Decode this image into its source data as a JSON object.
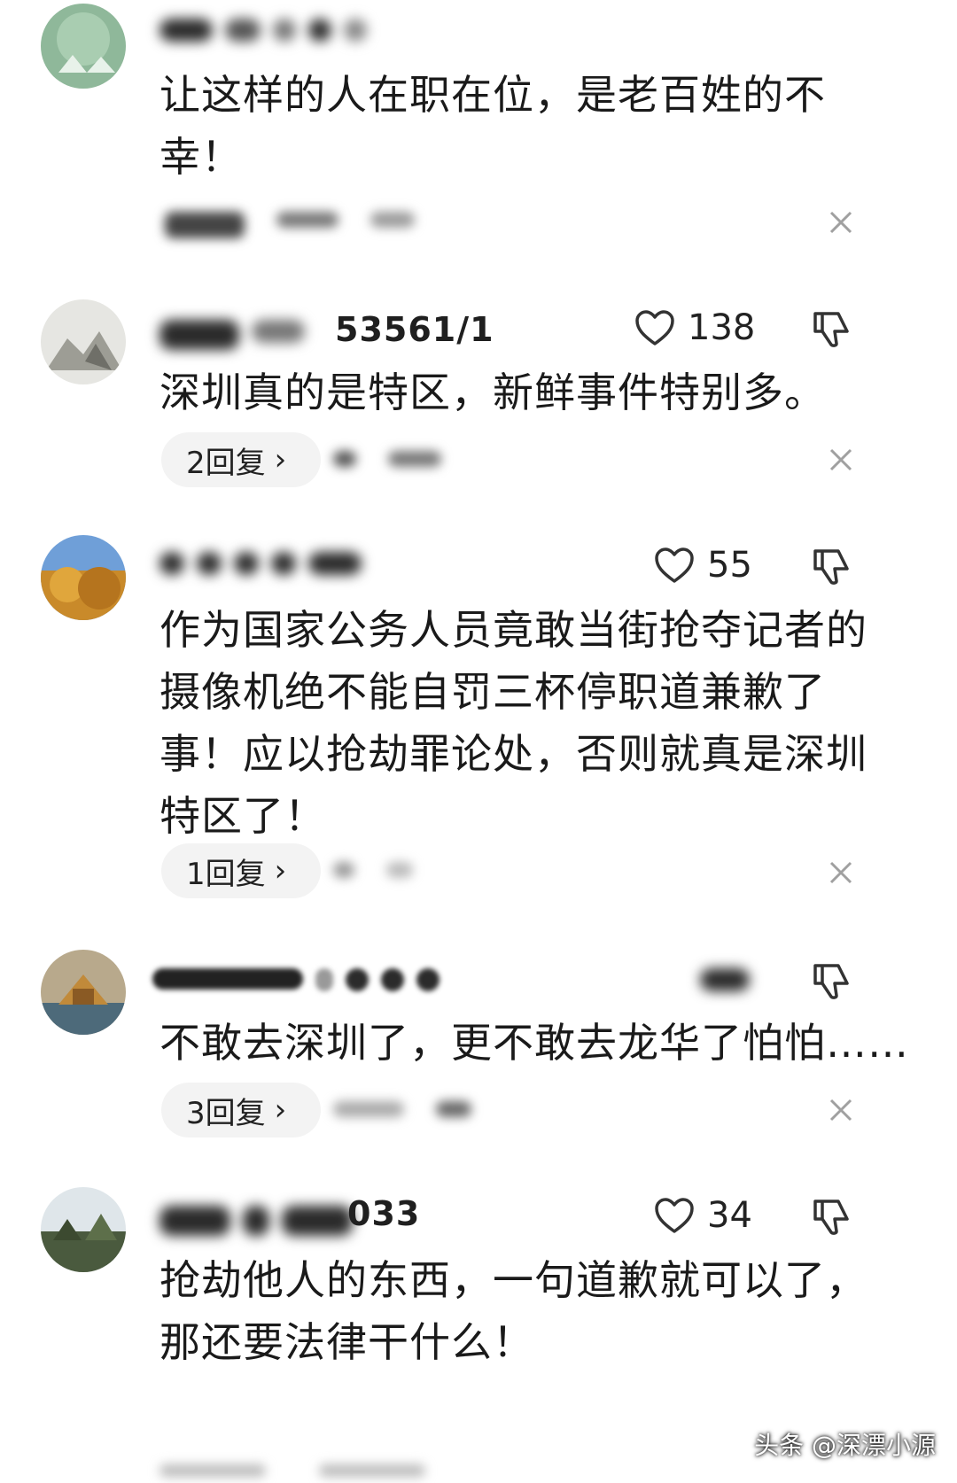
{
  "comments": [
    {
      "username_suffix": "",
      "likes": "",
      "text": "让这样的人在职在位，是老百姓的不幸！",
      "reply_label": ""
    },
    {
      "username_suffix": "53561/1",
      "likes": "138",
      "text": "深圳真的是特区，新鲜事件特别多。",
      "reply_label": "2回复"
    },
    {
      "username_suffix": "",
      "likes": "55",
      "text": "作为国家公务人员竟敢当街抢夺记者的摄像机绝不能自罚三杯停职道兼歉了事！应以抢劫罪论处，否则就真是深圳特区了！",
      "reply_label": "1回复"
    },
    {
      "username_suffix": "",
      "likes": "",
      "text": "不敢去深圳了，更不敢去龙华了怕怕……",
      "reply_label": "3回复"
    },
    {
      "username_suffix": "033",
      "likes": "34",
      "text": "抢劫他人的东西，一句道歉就可以了，那还要法律干什么！",
      "reply_label": ""
    }
  ],
  "watermark": "头条 @深漂小源",
  "icons": {
    "like": "heart-outline-icon",
    "dislike": "thumbs-down-outline-icon",
    "close": "close-icon",
    "chevron": "chevron-right-icon"
  },
  "colors": {
    "text": "#1a1a1a",
    "pill_bg": "#f3f3f3",
    "icon": "#333333"
  }
}
